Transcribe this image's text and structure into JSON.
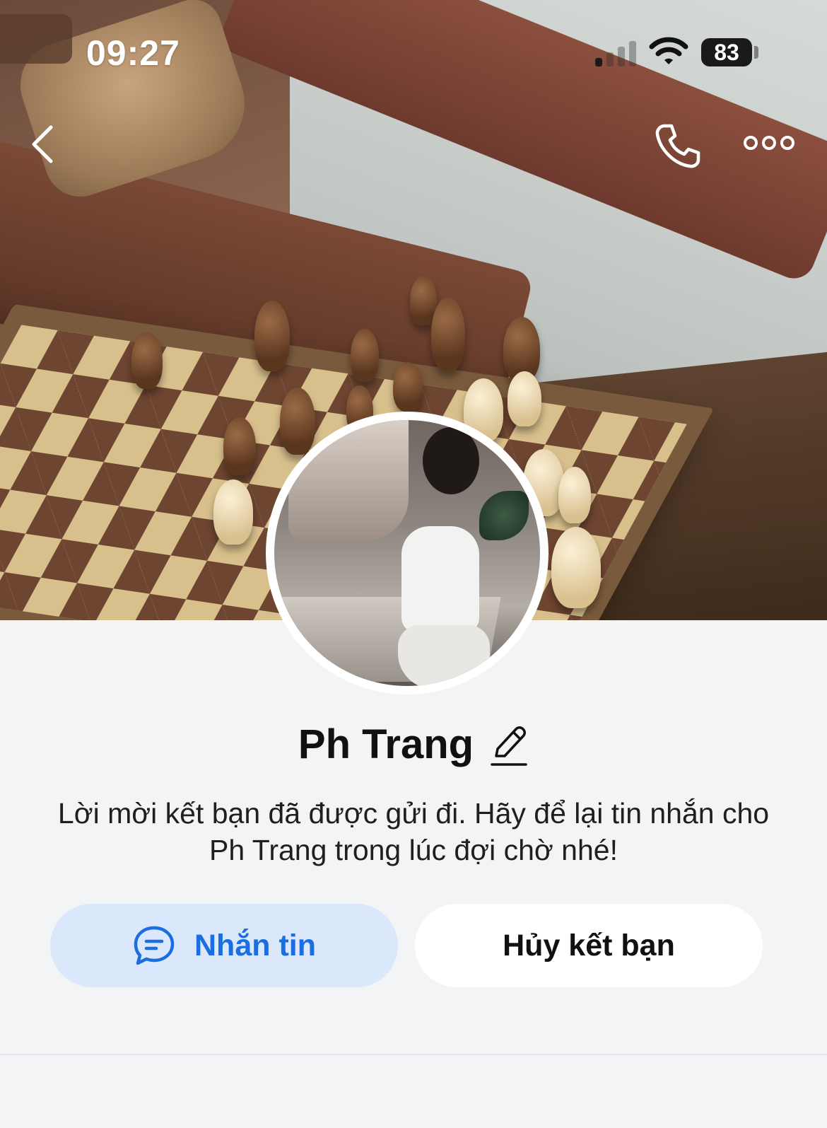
{
  "status_bar": {
    "time": "09:27",
    "battery": "83",
    "icons": [
      "signal-icon",
      "wifi-icon",
      "battery-icon"
    ]
  },
  "nav": {
    "icons": [
      "back-icon",
      "phone-icon",
      "more-icon"
    ]
  },
  "profile": {
    "name": "Ph Trang",
    "message": "Lời mời kết bạn đã được gửi đi. Hãy để lại tin nhắn cho Ph Trang trong lúc đợi chờ nhé!"
  },
  "actions": {
    "message_label": "Nhắn tin",
    "cancel_label": "Hủy kết bạn"
  },
  "colors": {
    "accent": "#1a6ee0",
    "accent_bg": "#dbe7fb",
    "page_bg": "#f3f4f6"
  }
}
